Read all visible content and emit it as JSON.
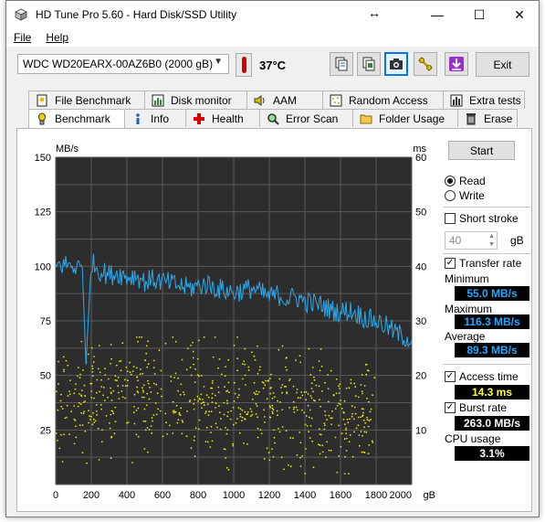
{
  "window": {
    "title": "HD Tune Pro 5.60 - Hard Disk/SSD Utility",
    "move_glyph": "↔"
  },
  "controls": {
    "minimize": "—",
    "maximize": "☐",
    "close": "✕"
  },
  "menu": {
    "file": "File",
    "help": "Help"
  },
  "toolbar": {
    "drive": "WDC WD20EARX-00AZ6B0 (2000 gB)",
    "temperature": "37°C",
    "buttons": [
      "copy-info-icon",
      "save-info-icon",
      "screenshot-icon",
      "options-icon",
      "download-icon"
    ],
    "exit": "Exit"
  },
  "tabs_row1": [
    {
      "label": "File Benchmark",
      "icon": "file-benchmark-icon"
    },
    {
      "label": "Disk monitor",
      "icon": "disk-monitor-icon"
    },
    {
      "label": "AAM",
      "icon": "speaker-icon"
    },
    {
      "label": "Random Access",
      "icon": "random-access-icon"
    },
    {
      "label": "Extra tests",
      "icon": "extra-tests-icon"
    }
  ],
  "tabs_row2": [
    {
      "label": "Benchmark",
      "icon": "benchmark-icon",
      "selected": true
    },
    {
      "label": "Info",
      "icon": "info-icon"
    },
    {
      "label": "Health",
      "icon": "health-icon"
    },
    {
      "label": "Error Scan",
      "icon": "error-scan-icon"
    },
    {
      "label": "Folder Usage",
      "icon": "folder-icon"
    },
    {
      "label": "Erase",
      "icon": "erase-icon"
    }
  ],
  "side": {
    "start": "Start",
    "read": "Read",
    "write": "Write",
    "short_stroke": "Short stroke",
    "stroke_value": "40",
    "stroke_unit": "gB",
    "transfer_rate": "Transfer rate",
    "minimum_label": "Minimum",
    "minimum": "55.0 MB/s",
    "maximum_label": "Maximum",
    "maximum": "116.3 MB/s",
    "average_label": "Average",
    "average": "89.3 MB/s",
    "access_time": "Access time",
    "access_value": "14.3 ms",
    "burst_rate": "Burst rate",
    "burst_value": "263.0 MB/s",
    "cpu_usage": "CPU usage",
    "cpu_value": "3.1%"
  },
  "colors": {
    "transfer_line": "#2aa9ec",
    "access_dots": "#e6e600",
    "value_blue": "#20a8ff",
    "value_yellow": "#ffff40",
    "value_white": "#ffffff",
    "plot_bg": "#2d2d2d",
    "grid": "#5a5a5a"
  },
  "chart_data": {
    "type": "line",
    "ylabel_left": "MB/s",
    "ylabel_right": "ms",
    "xlabel": "gB",
    "x_ticks": [
      "0",
      "200",
      "400",
      "600",
      "800",
      "1000",
      "1200",
      "1400",
      "1600",
      "1800",
      "2000"
    ],
    "y_left_ticks": [
      "150",
      "125",
      "100",
      "75",
      "50",
      "25"
    ],
    "y_right_ticks": [
      "60",
      "50",
      "40",
      "30",
      "20",
      "10"
    ],
    "xlim": [
      0,
      2000
    ],
    "ylim_left": [
      0,
      150
    ],
    "ylim_right": [
      0,
      60
    ],
    "grid": true,
    "series": [
      {
        "name": "Transfer rate",
        "x": [
          0,
          50,
          100,
          150,
          170,
          200,
          250,
          300,
          350,
          400,
          450,
          500,
          550,
          600,
          650,
          700,
          750,
          800,
          850,
          900,
          950,
          1000,
          1050,
          1100,
          1150,
          1200,
          1250,
          1300,
          1350,
          1400,
          1450,
          1500,
          1550,
          1600,
          1650,
          1700,
          1750,
          1800,
          1850,
          1900,
          1950,
          2000
        ],
        "y": [
          100,
          101,
          100,
          99,
          55,
          102,
          98,
          96,
          97,
          95,
          96,
          93,
          94,
          93,
          92,
          91,
          90,
          91,
          92,
          90,
          89,
          88,
          89,
          90,
          88,
          86,
          87,
          85,
          86,
          84,
          83,
          82,
          80,
          79,
          80,
          78,
          76,
          75,
          73,
          70,
          68,
          66
        ]
      },
      {
        "name": "Access time",
        "type": "scatter",
        "x_range": [
          0,
          1800
        ],
        "y_range_ms": [
          2,
          27
        ],
        "mean_ms": 14.3
      }
    ]
  }
}
